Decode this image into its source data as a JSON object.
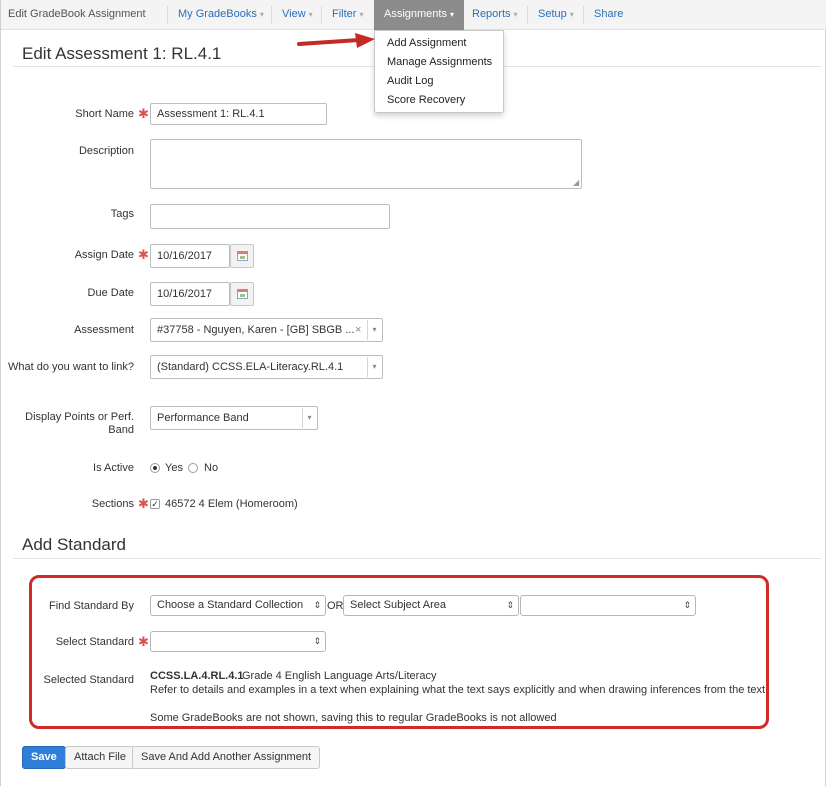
{
  "nav": {
    "brand": "Edit GradeBook Assignment",
    "items": [
      {
        "label": "My GradeBooks"
      },
      {
        "label": "View"
      },
      {
        "label": "Filter"
      },
      {
        "label": "Assignments"
      },
      {
        "label": "Reports"
      },
      {
        "label": "Setup"
      },
      {
        "label": "Share"
      }
    ]
  },
  "assignments_menu": {
    "items": [
      "Add Assignment",
      "Manage Assignments",
      "Audit Log",
      "Score Recovery"
    ]
  },
  "page_title": "Edit Assessment 1: RL.4.1",
  "form": {
    "short_name": {
      "label": "Short Name",
      "value": "Assessment 1: RL.4.1"
    },
    "description": {
      "label": "Description",
      "value": ""
    },
    "tags": {
      "label": "Tags",
      "value": ""
    },
    "assign_date": {
      "label": "Assign Date",
      "value": "10/16/2017"
    },
    "due_date": {
      "label": "Due Date",
      "value": "10/16/2017"
    },
    "assessment": {
      "label": "Assessment",
      "value": "#37758 - Nguyen, Karen - [GB] SBGB ..."
    },
    "link": {
      "label": "What do you want to link?",
      "value": "(Standard) CCSS.ELA-Literacy.RL.4.1"
    },
    "display": {
      "label": "Display Points or Perf. Band",
      "value": "Performance Band"
    },
    "is_active": {
      "label": "Is Active",
      "yes": "Yes",
      "no": "No"
    },
    "sections": {
      "label": "Sections",
      "value": "46572 4 Elem (Homeroom)"
    }
  },
  "add_standard": {
    "title": "Add Standard",
    "find_label": "Find Standard By",
    "collection_value": "Choose a Standard Collection",
    "or_label": "OR",
    "subject_value": "Select Subject Area",
    "third_value": "",
    "select_label": "Select Standard",
    "select_value": "",
    "selected_label": "Selected Standard",
    "selected_code": "CCSS.LA.4.RL.4.1",
    "selected_grade": "Grade 4 English Language Arts/Literacy",
    "selected_desc": "Refer to details and examples in a text when explaining what the text says explicitly and when drawing inferences from the text.",
    "note": "Some GradeBooks are not shown, saving this to regular GradeBooks is not allowed"
  },
  "buttons": {
    "save": "Save",
    "attach": "Attach File",
    "save_add": "Save And Add Another Assignment"
  },
  "colors": {
    "link": "#2a6ebb",
    "required": "#d9534f",
    "highlight": "#d22b25",
    "primary": "#2f7fd8"
  }
}
